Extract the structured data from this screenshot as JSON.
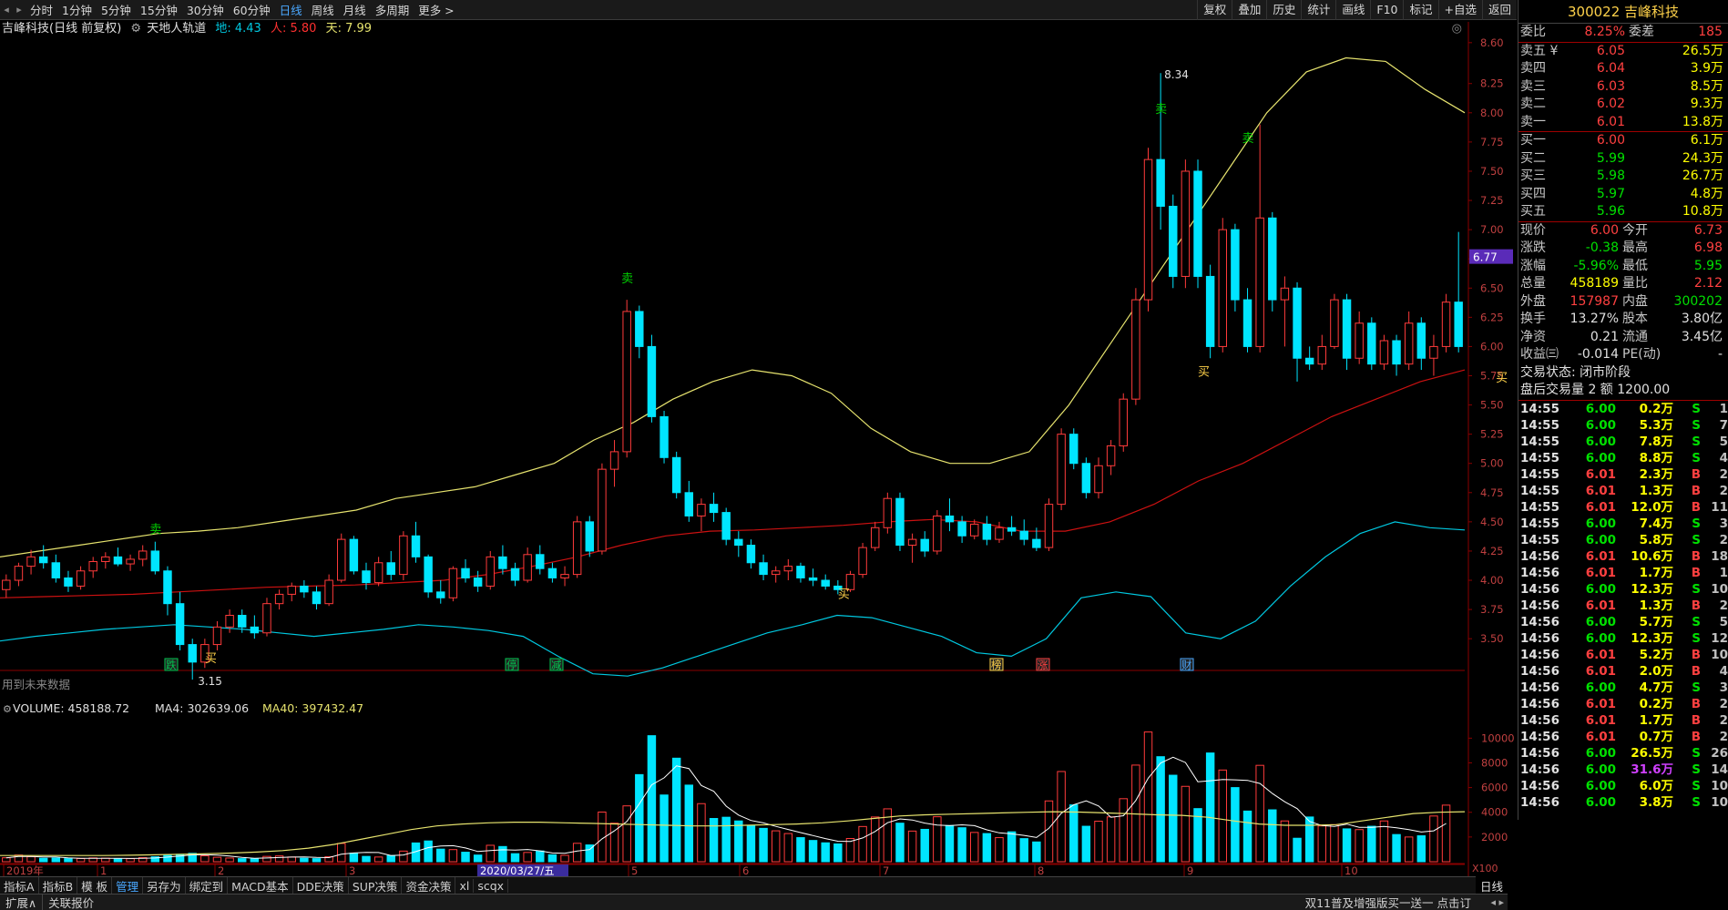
{
  "toolbar": {
    "periods": [
      "分时",
      "1分钟",
      "5分钟",
      "15分钟",
      "30分钟",
      "60分钟",
      "日线",
      "周线",
      "月线",
      "多周期",
      "更多 >"
    ],
    "active_period": "日线",
    "tools": [
      "复权",
      "叠加",
      "历史",
      "统计",
      "画线",
      "F10",
      "标记",
      "+自选",
      "返回"
    ]
  },
  "info": {
    "stock_title": "吉峰科技(日线 前复权)",
    "indicator_name": "天地人轨道",
    "di": "地: 4.43",
    "ren": "人: 5.80",
    "tian": "天: 7.99",
    "future_data": "用到未来数据"
  },
  "volume_info": {
    "volume": "VOLUME: 458188.72",
    "ma4": "MA4: 302639.06",
    "ma40": "MA40: 397432.47"
  },
  "price_axis": [
    "8.60",
    "8.25",
    "8.00",
    "7.75",
    "7.50",
    "7.25",
    "7.00",
    "6.75",
    "6.50",
    "6.25",
    "6.00",
    "5.75",
    "5.50",
    "5.25",
    "5.00",
    "4.75",
    "4.50",
    "4.25",
    "4.00",
    "3.75",
    "3.50"
  ],
  "price_tag": "6.77",
  "volume_axis": [
    "10000",
    "8000",
    "6000",
    "4000",
    "2000"
  ],
  "volume_unit": "X100",
  "date_axis": [
    "2019年",
    "1",
    "2",
    "3",
    "4",
    "5",
    "6",
    "7",
    "8",
    "9",
    "10"
  ],
  "cursor_date": "2020/03/27/五",
  "mode_label": "日线",
  "annotations": {
    "high": "8.34",
    "low": "3.15",
    "buy": "买",
    "sell": "卖",
    "events": [
      "跌",
      "停",
      "减",
      "榜",
      "涨",
      "财"
    ]
  },
  "quote": {
    "code_name": "300022 吉峰科技",
    "weibi_label": "委比",
    "weibi": "8.25%",
    "weicha_label": "委差",
    "weicha": "185",
    "asks": [
      {
        "label": "卖五 ¥",
        "price": "6.05",
        "vol": "26.5万"
      },
      {
        "label": "卖四",
        "price": "6.04",
        "vol": "3.9万"
      },
      {
        "label": "卖三",
        "price": "6.03",
        "vol": "8.5万"
      },
      {
        "label": "卖二",
        "price": "6.02",
        "vol": "9.3万"
      },
      {
        "label": "卖一",
        "price": "6.01",
        "vol": "13.8万"
      }
    ],
    "bids": [
      {
        "label": "买一",
        "price": "6.00",
        "vol": "6.1万"
      },
      {
        "label": "买二",
        "price": "5.99",
        "vol": "24.3万"
      },
      {
        "label": "买三",
        "price": "5.98",
        "vol": "26.7万"
      },
      {
        "label": "买四",
        "price": "5.97",
        "vol": "4.8万"
      },
      {
        "label": "买五",
        "price": "5.96",
        "vol": "10.8万"
      }
    ],
    "stats": [
      {
        "l1": "现价",
        "v1": "6.00",
        "c1": "#ff4040",
        "l2": "今开",
        "v2": "6.73",
        "c2": "#ff4040"
      },
      {
        "l1": "涨跌",
        "v1": "-0.38",
        "c1": "#00e000",
        "l2": "最高",
        "v2": "6.98",
        "c2": "#ff4040"
      },
      {
        "l1": "涨幅",
        "v1": "-5.96%",
        "c1": "#00e000",
        "l2": "最低",
        "v2": "5.95",
        "c2": "#00e000"
      },
      {
        "l1": "总量",
        "v1": "458189",
        "c1": "#ffff00",
        "l2": "量比",
        "v2": "2.12",
        "c2": "#ff4040"
      },
      {
        "l1": "外盘",
        "v1": "157987",
        "c1": "#ff4040",
        "l2": "内盘",
        "v2": "300202",
        "c2": "#00e000"
      },
      {
        "l1": "换手",
        "v1": "13.27%",
        "c1": "#e0e0e0",
        "l2": "股本",
        "v2": "3.80亿",
        "c2": "#e0e0e0"
      },
      {
        "l1": "净资",
        "v1": "0.21",
        "c1": "#e0e0e0",
        "l2": "流通",
        "v2": "3.45亿",
        "c2": "#e0e0e0"
      },
      {
        "l1": "收益㈢",
        "v1": "-0.014",
        "c1": "#e0e0e0",
        "l2": "PE(动)",
        "v2": "-",
        "c2": "#e0e0e0"
      }
    ],
    "trade_state": "交易状态: 闭市阶段",
    "after_hours": "盘后交易量 2 额 1200.00"
  },
  "ticks": [
    {
      "t": "14:55",
      "p": "6.00",
      "v": "0.2万",
      "d": "S",
      "n": "1"
    },
    {
      "t": "14:55",
      "p": "6.00",
      "v": "5.3万",
      "d": "S",
      "n": "7"
    },
    {
      "t": "14:55",
      "p": "6.00",
      "v": "7.8万",
      "d": "S",
      "n": "5"
    },
    {
      "t": "14:55",
      "p": "6.00",
      "v": "8.8万",
      "d": "S",
      "n": "4"
    },
    {
      "t": "14:55",
      "p": "6.01",
      "v": "2.3万",
      "d": "B",
      "n": "2"
    },
    {
      "t": "14:55",
      "p": "6.01",
      "v": "1.3万",
      "d": "B",
      "n": "2"
    },
    {
      "t": "14:55",
      "p": "6.01",
      "v": "12.0万",
      "d": "B",
      "n": "11"
    },
    {
      "t": "14:55",
      "p": "6.00",
      "v": "7.4万",
      "d": "S",
      "n": "3"
    },
    {
      "t": "14:55",
      "p": "6.00",
      "v": "5.8万",
      "d": "S",
      "n": "2"
    },
    {
      "t": "14:56",
      "p": "6.01",
      "v": "10.6万",
      "d": "B",
      "n": "18"
    },
    {
      "t": "14:56",
      "p": "6.01",
      "v": "1.7万",
      "d": "B",
      "n": "1"
    },
    {
      "t": "14:56",
      "p": "6.00",
      "v": "12.3万",
      "d": "S",
      "n": "10"
    },
    {
      "t": "14:56",
      "p": "6.01",
      "v": "1.3万",
      "d": "B",
      "n": "2"
    },
    {
      "t": "14:56",
      "p": "6.00",
      "v": "5.7万",
      "d": "S",
      "n": "5"
    },
    {
      "t": "14:56",
      "p": "6.00",
      "v": "12.3万",
      "d": "S",
      "n": "12"
    },
    {
      "t": "14:56",
      "p": "6.01",
      "v": "5.2万",
      "d": "B",
      "n": "10"
    },
    {
      "t": "14:56",
      "p": "6.01",
      "v": "2.0万",
      "d": "B",
      "n": "4"
    },
    {
      "t": "14:56",
      "p": "6.00",
      "v": "4.7万",
      "d": "S",
      "n": "3"
    },
    {
      "t": "14:56",
      "p": "6.01",
      "v": "0.2万",
      "d": "B",
      "n": "2"
    },
    {
      "t": "14:56",
      "p": "6.01",
      "v": "1.7万",
      "d": "B",
      "n": "2"
    },
    {
      "t": "14:56",
      "p": "6.01",
      "v": "0.7万",
      "d": "B",
      "n": "2"
    },
    {
      "t": "14:56",
      "p": "6.00",
      "v": "26.5万",
      "d": "S",
      "n": "26"
    },
    {
      "t": "14:56",
      "p": "6.00",
      "v": "31.6万",
      "d": "S",
      "n": "14"
    },
    {
      "t": "14:56",
      "p": "6.00",
      "v": "6.0万",
      "d": "S",
      "n": "10"
    },
    {
      "t": "14:56",
      "p": "6.00",
      "v": "3.8万",
      "d": "S",
      "n": "10"
    }
  ],
  "bottom_tabs": [
    "指标A",
    "指标B",
    "模 板",
    "管理",
    "另存为",
    "绑定到",
    "MACD基本",
    "DDE决策",
    "SUP决策",
    "资金决策",
    "xl",
    "scqx"
  ],
  "active_tab": "管理",
  "status": {
    "expand": "扩展∧",
    "related": "关联报价",
    "ticker": "双11普及增强版买一送一 点击订"
  },
  "colors": {
    "up": "#ff3b3b",
    "down": "#00e5ff",
    "tian": "#e6e36e",
    "ren": "#cc1111",
    "di": "#00c8e0",
    "ma4": "#ffffff",
    "ma40": "#e6e36e"
  },
  "chart_data": {
    "type": "candlestick",
    "ylim": [
      3.4,
      8.7
    ],
    "candles": [
      [
        3.92,
        4.05,
        3.85,
        4.0
      ],
      [
        4.0,
        4.15,
        3.95,
        4.12
      ],
      [
        4.12,
        4.26,
        4.05,
        4.2
      ],
      [
        4.2,
        4.3,
        4.1,
        4.15
      ],
      [
        4.15,
        4.22,
        3.98,
        4.02
      ],
      [
        4.02,
        4.08,
        3.9,
        3.95
      ],
      [
        3.95,
        4.12,
        3.92,
        4.08
      ],
      [
        4.08,
        4.2,
        4.02,
        4.16
      ],
      [
        4.16,
        4.24,
        4.1,
        4.2
      ],
      [
        4.2,
        4.28,
        4.12,
        4.14
      ],
      [
        4.14,
        4.22,
        4.08,
        4.18
      ],
      [
        4.18,
        4.3,
        4.12,
        4.25
      ],
      [
        4.25,
        4.33,
        4.05,
        4.08
      ],
      [
        4.08,
        4.12,
        3.7,
        3.8
      ],
      [
        3.8,
        3.9,
        3.4,
        3.45
      ],
      [
        3.45,
        3.5,
        3.15,
        3.3
      ],
      [
        3.3,
        3.5,
        3.25,
        3.45
      ],
      [
        3.45,
        3.65,
        3.4,
        3.6
      ],
      [
        3.6,
        3.75,
        3.55,
        3.7
      ],
      [
        3.7,
        3.75,
        3.55,
        3.6
      ],
      [
        3.6,
        3.7,
        3.5,
        3.55
      ],
      [
        3.55,
        3.85,
        3.52,
        3.8
      ],
      [
        3.8,
        3.92,
        3.75,
        3.88
      ],
      [
        3.88,
        3.98,
        3.82,
        3.95
      ],
      [
        3.95,
        4.0,
        3.85,
        3.9
      ],
      [
        3.9,
        3.95,
        3.75,
        3.8
      ],
      [
        3.8,
        4.05,
        3.78,
        4.0
      ],
      [
        4.0,
        4.4,
        3.98,
        4.35
      ],
      [
        4.35,
        4.38,
        4.05,
        4.08
      ],
      [
        4.08,
        4.15,
        3.92,
        3.98
      ],
      [
        3.98,
        4.2,
        3.95,
        4.15
      ],
      [
        4.15,
        4.25,
        4.0,
        4.05
      ],
      [
        4.05,
        4.42,
        4.0,
        4.38
      ],
      [
        4.38,
        4.5,
        4.15,
        4.2
      ],
      [
        4.2,
        4.22,
        3.85,
        3.9
      ],
      [
        3.9,
        4.0,
        3.8,
        3.85
      ],
      [
        3.85,
        4.12,
        3.82,
        4.1
      ],
      [
        4.1,
        4.18,
        3.98,
        4.02
      ],
      [
        4.02,
        4.08,
        3.9,
        3.95
      ],
      [
        3.95,
        4.25,
        3.92,
        4.2
      ],
      [
        4.2,
        4.3,
        4.05,
        4.1
      ],
      [
        4.1,
        4.15,
        3.95,
        4.0
      ],
      [
        4.0,
        4.28,
        3.98,
        4.22
      ],
      [
        4.22,
        4.3,
        4.05,
        4.1
      ],
      [
        4.1,
        4.15,
        3.98,
        4.02
      ],
      [
        4.02,
        4.12,
        3.95,
        4.05
      ],
      [
        4.05,
        4.55,
        4.02,
        4.5
      ],
      [
        4.5,
        4.55,
        4.2,
        4.25
      ],
      [
        4.25,
        5.0,
        4.22,
        4.95
      ],
      [
        4.95,
        5.2,
        4.8,
        5.1
      ],
      [
        5.1,
        6.4,
        5.05,
        6.3
      ],
      [
        6.3,
        6.35,
        5.9,
        6.0
      ],
      [
        6.0,
        6.1,
        5.35,
        5.4
      ],
      [
        5.4,
        5.45,
        5.0,
        5.05
      ],
      [
        5.05,
        5.1,
        4.7,
        4.75
      ],
      [
        4.75,
        4.85,
        4.5,
        4.55
      ],
      [
        4.55,
        4.7,
        4.42,
        4.65
      ],
      [
        4.65,
        4.75,
        4.5,
        4.58
      ],
      [
        4.58,
        4.62,
        4.3,
        4.35
      ],
      [
        4.35,
        4.42,
        4.2,
        4.3
      ],
      [
        4.3,
        4.35,
        4.1,
        4.15
      ],
      [
        4.15,
        4.22,
        4.0,
        4.05
      ],
      [
        4.05,
        4.12,
        3.98,
        4.08
      ],
      [
        4.08,
        4.18,
        4.0,
        4.12
      ],
      [
        4.12,
        4.15,
        3.98,
        4.02
      ],
      [
        4.02,
        4.1,
        3.95,
        4.0
      ],
      [
        4.0,
        4.05,
        3.92,
        3.95
      ],
      [
        3.95,
        4.0,
        3.88,
        3.92
      ],
      [
        3.92,
        4.08,
        3.9,
        4.05
      ],
      [
        4.05,
        4.32,
        4.02,
        4.28
      ],
      [
        4.28,
        4.5,
        4.25,
        4.45
      ],
      [
        4.45,
        4.75,
        4.4,
        4.7
      ],
      [
        4.7,
        4.75,
        4.25,
        4.3
      ],
      [
        4.3,
        4.4,
        4.15,
        4.35
      ],
      [
        4.35,
        4.42,
        4.2,
        4.25
      ],
      [
        4.25,
        4.6,
        4.22,
        4.55
      ],
      [
        4.55,
        4.7,
        4.42,
        4.5
      ],
      [
        4.5,
        4.55,
        4.32,
        4.38
      ],
      [
        4.38,
        4.52,
        4.35,
        4.48
      ],
      [
        4.48,
        4.55,
        4.3,
        4.35
      ],
      [
        4.35,
        4.5,
        4.32,
        4.45
      ],
      [
        4.45,
        4.55,
        4.38,
        4.42
      ],
      [
        4.42,
        4.52,
        4.3,
        4.35
      ],
      [
        4.35,
        4.45,
        4.25,
        4.28
      ],
      [
        4.28,
        4.7,
        4.25,
        4.65
      ],
      [
        4.65,
        5.3,
        4.6,
        5.25
      ],
      [
        5.25,
        5.3,
        4.95,
        5.0
      ],
      [
        5.0,
        5.05,
        4.7,
        4.75
      ],
      [
        4.75,
        5.05,
        4.7,
        4.98
      ],
      [
        4.98,
        5.2,
        4.9,
        5.15
      ],
      [
        5.15,
        5.6,
        5.1,
        5.55
      ],
      [
        5.55,
        6.5,
        5.5,
        6.4
      ],
      [
        6.4,
        7.7,
        6.3,
        7.6
      ],
      [
        7.6,
        8.34,
        7.0,
        7.2
      ],
      [
        7.2,
        7.3,
        6.5,
        6.6
      ],
      [
        6.6,
        7.6,
        6.5,
        7.5
      ],
      [
        7.5,
        7.6,
        6.5,
        6.6
      ],
      [
        6.6,
        6.7,
        5.9,
        6.0
      ],
      [
        6.0,
        7.1,
        5.95,
        7.0
      ],
      [
        7.0,
        7.05,
        6.3,
        6.4
      ],
      [
        6.4,
        6.5,
        5.95,
        6.0
      ],
      [
        6.0,
        7.9,
        5.95,
        7.1
      ],
      [
        7.1,
        7.15,
        6.3,
        6.4
      ],
      [
        6.4,
        6.6,
        6.0,
        6.5
      ],
      [
        6.5,
        6.55,
        5.7,
        5.9
      ],
      [
        5.9,
        6.0,
        5.8,
        5.85
      ],
      [
        5.85,
        6.1,
        5.8,
        6.0
      ],
      [
        6.0,
        6.45,
        5.98,
        6.4
      ],
      [
        6.4,
        6.45,
        5.8,
        5.9
      ],
      [
        5.9,
        6.3,
        5.85,
        6.2
      ],
      [
        6.2,
        6.25,
        5.8,
        5.85
      ],
      [
        5.85,
        6.1,
        5.8,
        6.05
      ],
      [
        6.05,
        6.1,
        5.75,
        5.85
      ],
      [
        5.85,
        6.3,
        5.8,
        6.2
      ],
      [
        6.2,
        6.25,
        5.8,
        5.9
      ],
      [
        5.9,
        6.1,
        5.75,
        6.0
      ],
      [
        6.0,
        6.45,
        5.95,
        6.38
      ],
      [
        6.38,
        6.98,
        5.95,
        6.0
      ]
    ],
    "volumes": [
      320,
      540,
      410,
      280,
      300,
      250,
      260,
      310,
      290,
      220,
      250,
      330,
      400,
      520,
      600,
      680,
      480,
      360,
      300,
      250,
      220,
      430,
      470,
      380,
      280,
      250,
      410,
      1480,
      690,
      430,
      380,
      500,
      860,
      1520,
      1680,
      1020,
      980,
      770,
      540,
      1330,
      1230,
      650,
      750,
      870,
      560,
      520,
      1490,
      1360,
      4020,
      3120,
      4520,
      7050,
      10200,
      5400,
      8380,
      6200,
      4700,
      3500,
      3600,
      3300,
      2950,
      2700,
      2500,
      2280,
      1950,
      1720,
      1530,
      1440,
      1880,
      2850,
      3620,
      4280,
      3120,
      2480,
      2620,
      3640,
      2930,
      2750,
      2370,
      2280,
      1950,
      2420,
      1870,
      1600,
      4920,
      7300,
      4600,
      2870,
      3280,
      3630,
      5100,
      7820,
      10500,
      8500,
      7000,
      6100,
      4300,
      8800,
      7420,
      6000,
      4100,
      7800,
      4200,
      3300,
      1900,
      3620,
      2900,
      3000,
      2660,
      2600,
      2870,
      3300,
      2200,
      2000,
      2100,
      3700,
      4580
    ],
    "tian": [
      4.2,
      4.25,
      4.3,
      4.35,
      4.4,
      4.42,
      4.45,
      4.5,
      4.55,
      4.6,
      4.7,
      4.75,
      4.8,
      4.9,
      5.0,
      5.2,
      5.35,
      5.55,
      5.7,
      5.8,
      5.75,
      5.6,
      5.3,
      5.1,
      5.0,
      5.0,
      5.1,
      5.5,
      6.0,
      6.5,
      7.0,
      7.5,
      8.0,
      8.35,
      8.47,
      8.44,
      8.2,
      8.0
    ],
    "ren": [
      3.85,
      3.86,
      3.87,
      3.88,
      3.9,
      3.92,
      3.94,
      3.95,
      3.96,
      3.98,
      4.0,
      4.05,
      4.12,
      4.2,
      4.3,
      4.38,
      4.42,
      4.43,
      4.45,
      4.47,
      4.5,
      4.52,
      4.5,
      4.42,
      4.42,
      4.5,
      4.65,
      4.85,
      5.0,
      5.2,
      5.4,
      5.55,
      5.7,
      5.8
    ],
    "di": [
      3.48,
      3.52,
      3.55,
      3.58,
      3.6,
      3.62,
      3.6,
      3.58,
      3.55,
      3.52,
      3.55,
      3.58,
      3.62,
      3.6,
      3.57,
      3.52,
      3.35,
      3.2,
      3.18,
      3.25,
      3.35,
      3.45,
      3.55,
      3.62,
      3.7,
      3.68,
      3.6,
      3.52,
      3.38,
      3.35,
      3.5,
      3.85,
      3.9,
      3.86,
      3.55,
      3.5,
      3.65,
      3.95,
      4.2,
      4.4,
      4.5,
      4.45,
      4.43
    ],
    "ma40": [
      500,
      500,
      500,
      500,
      500,
      520,
      560,
      600,
      650,
      700,
      780,
      900,
      1100,
      1400,
      1800,
      2200,
      2600,
      2900,
      3050,
      3150,
      3200,
      3200,
      3150,
      3100,
      3050,
      3000,
      2950,
      2900,
      2900,
      2950,
      3000,
      3050,
      3150,
      3300,
      3500,
      3700,
      3800,
      3850,
      3900,
      3950,
      4000,
      4050,
      4020,
      3950,
      3880,
      3800,
      3750,
      3600,
      3300,
      3050,
      2950,
      2950,
      3000,
      3300,
      3600,
      3900,
      4000,
      4050
    ]
  }
}
